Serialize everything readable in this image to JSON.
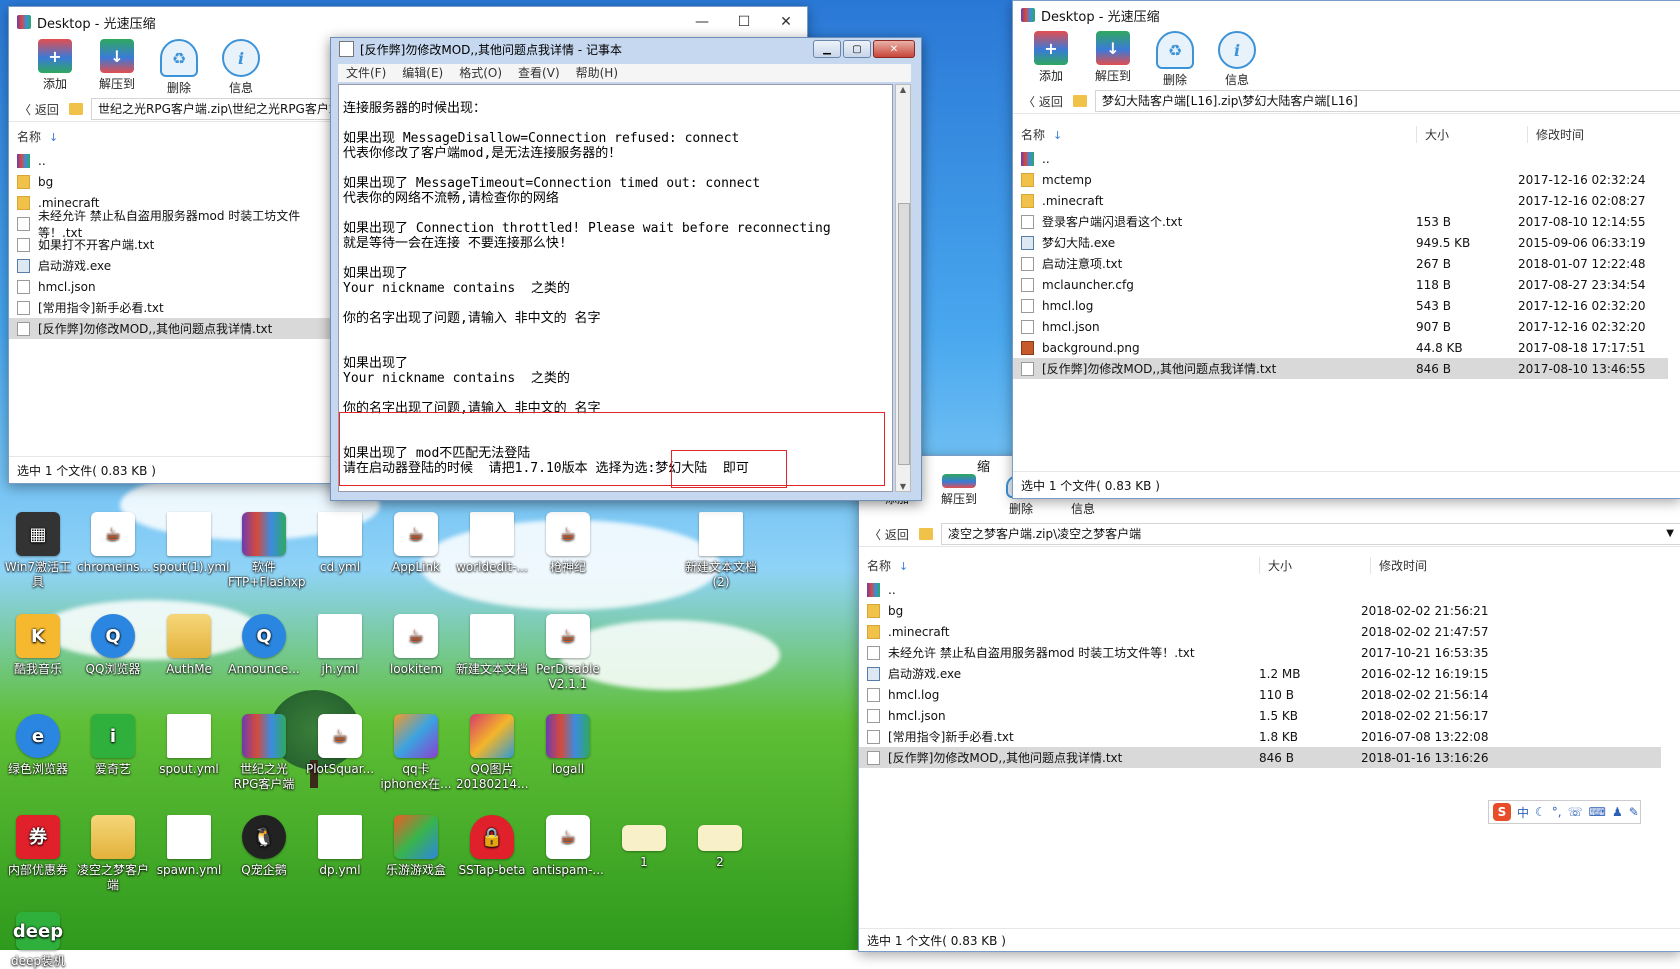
{
  "desktop_icons": [
    {
      "label": "Win7激活工具"
    },
    {
      "label": "chromeins..."
    },
    {
      "label": "spout(1).yml"
    },
    {
      "label": "软件FTP+Flashxp"
    },
    {
      "label": "cd.yml"
    },
    {
      "label": "AppLink"
    },
    {
      "label": "worldedit-..."
    },
    {
      "label": "枪神纪"
    },
    {
      "label": "新建文本文档(2)"
    },
    {
      "label": "酷我音乐"
    },
    {
      "label": "QQ浏览器"
    },
    {
      "label": "AuthMe"
    },
    {
      "label": "Announce..."
    },
    {
      "label": "jh.yml"
    },
    {
      "label": "lookitem"
    },
    {
      "label": "新建文本文档"
    },
    {
      "label": "PerDisable V2.1.1"
    },
    {
      "label": "绿色浏览器"
    },
    {
      "label": "爱奇艺"
    },
    {
      "label": "spout.yml"
    },
    {
      "label": "世纪之光RPG客户端"
    },
    {
      "label": "PlotSquar..."
    },
    {
      "label": "qq卡iphonex在..."
    },
    {
      "label": "QQ图片20180214..."
    },
    {
      "label": "logall"
    },
    {
      "label": "内部优惠券"
    },
    {
      "label": "凌空之梦客户端"
    },
    {
      "label": "spawn.yml"
    },
    {
      "label": "Q宠企鹅"
    },
    {
      "label": "dp.yml"
    },
    {
      "label": "乐游游戏盒"
    },
    {
      "label": "SSTap-beta"
    },
    {
      "label": "antispam-..."
    },
    {
      "label": "1"
    },
    {
      "label": "2"
    },
    {
      "label": "deep装机"
    }
  ],
  "win1": {
    "title": "Desktop - 光速压缩",
    "toolbar": {
      "add": "添加",
      "extract": "解压到",
      "delete": "删除",
      "info": "信息"
    },
    "back": "返回",
    "path": "世纪之光RPG客户端.zip\\世纪之光RPG客户端",
    "col_name": "名称",
    "rows": [
      "..",
      "bg",
      ".minecraft",
      "未经允许 禁止私自盗用服务器mod 时装工坊文件等！.txt",
      "如果打不开客户端.txt",
      "启动游戏.exe",
      "hmcl.json",
      "[常用指令]新手必看.txt",
      "[反作弊]勿修改MOD,,其他问题点我详情.txt"
    ],
    "status": "选中 1 个文件( 0.83 KB )"
  },
  "win2": {
    "title": "Desktop - 光速压缩",
    "toolbar": {
      "add": "添加",
      "extract": "解压到",
      "delete": "删除",
      "info": "信息"
    },
    "back": "返回",
    "path": "梦幻大陆客户端[L16].zip\\梦幻大陆客户端[L16]",
    "col_name": "名称",
    "col_size": "大小",
    "col_time": "修改时间",
    "rows": [
      {
        "name": "..",
        "size": "",
        "time": ""
      },
      {
        "name": "mctemp",
        "size": "",
        "time": "2017-12-16 02:32:24"
      },
      {
        "name": ".minecraft",
        "size": "",
        "time": "2017-12-16 02:08:27"
      },
      {
        "name": "登录客户端闪退看这个.txt",
        "size": "153 B",
        "time": "2017-08-10 12:14:55"
      },
      {
        "name": "梦幻大陆.exe",
        "size": "949.5 KB",
        "time": "2015-09-06 06:33:19"
      },
      {
        "name": "启动注意项.txt",
        "size": "267 B",
        "time": "2018-01-07 12:22:48"
      },
      {
        "name": "mclauncher.cfg",
        "size": "118 B",
        "time": "2017-08-27 23:34:54"
      },
      {
        "name": "hmcl.log",
        "size": "543 B",
        "time": "2017-12-16 02:32:20"
      },
      {
        "name": "hmcl.json",
        "size": "907 B",
        "time": "2017-12-16 02:32:20"
      },
      {
        "name": "background.png",
        "size": "44.8 KB",
        "time": "2017-08-18 17:17:51"
      },
      {
        "name": "[反作弊]勿修改MOD,,其他问题点我详情.txt",
        "size": "846 B",
        "time": "2017-08-10 13:46:55"
      }
    ],
    "status": "选中 1 个文件( 0.83 KB )"
  },
  "win3": {
    "partial_title": "缩",
    "toolbar": {
      "add": "添加",
      "extract": "解压到",
      "delete": "删除",
      "info": "信息"
    },
    "back": "返回",
    "path": "凌空之梦客户端.zip\\凌空之梦客户端",
    "col_name": "名称",
    "col_size": "大小",
    "col_time": "修改时间",
    "rows": [
      {
        "name": "..",
        "size": "",
        "time": ""
      },
      {
        "name": "bg",
        "size": "",
        "time": "2018-02-02 21:56:21"
      },
      {
        "name": ".minecraft",
        "size": "",
        "time": "2018-02-02 21:47:57"
      },
      {
        "name": "未经允许 禁止私自盗用服务器mod 时装工坊文件等！.txt",
        "size": "",
        "time": "2017-10-21 16:53:35"
      },
      {
        "name": "启动游戏.exe",
        "size": "1.2 MB",
        "time": "2016-02-12 16:19:15"
      },
      {
        "name": "hmcl.log",
        "size": "110 B",
        "time": "2018-02-02 21:56:14"
      },
      {
        "name": "hmcl.json",
        "size": "1.5 KB",
        "time": "2018-02-02 21:56:17"
      },
      {
        "name": "[常用指令]新手必看.txt",
        "size": "1.8 KB",
        "time": "2016-07-08 13:22:08"
      },
      {
        "name": "[反作弊]勿修改MOD,,其他问题点我详情.txt",
        "size": "846 B",
        "time": "2018-01-16 13:16:26"
      }
    ],
    "status": "选中 1 个文件( 0.83 KB )"
  },
  "notepad": {
    "title": "[反作弊]勿修改MOD,,其他问题点我详情 - 记事本",
    "menu": [
      "文件(F)",
      "编辑(E)",
      "格式(O)",
      "查看(V)",
      "帮助(H)"
    ],
    "lines": [
      "连接服务器的时候出现：",
      "",
      "如果出现 MessageDisallow=Connection refused: connect",
      "代表你修改了客户端mod,是无法连接服务器的！",
      "",
      "如果出现了 MessageTimeout=Connection timed out: connect",
      "代表你的网络不流畅,请检查你的网络",
      "",
      "如果出现了 Connection throttled! Please wait before reconnecting",
      "就是等待一会在连接 不要连接那么快!",
      "",
      "如果出现了",
      "Your nickname contains  之类的",
      "",
      "你的名字出现了问题,请输入 非中文的 名字",
      "",
      "",
      "如果出现了",
      "Your nickname contains  之类的",
      "",
      "你的名字出现了问题,请输入 非中文的 名字",
      "",
      "",
      "如果出现了 mod不匹配无法登陆",
      "请在启动器登陆的时候  请把1.7.10版本 选择为选:梦幻大陆  即可"
    ]
  },
  "tray": {
    "ime_mode": "中"
  }
}
